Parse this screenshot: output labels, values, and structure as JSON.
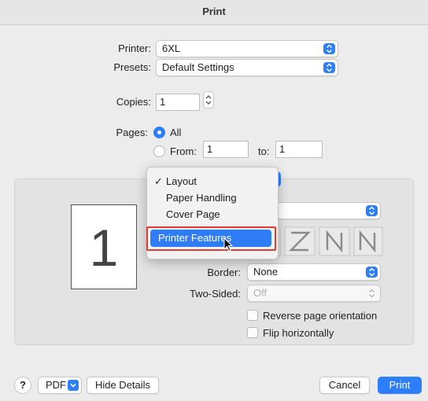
{
  "window": {
    "title": "Print"
  },
  "form": {
    "printer_label": "Printer:",
    "printer_value": "6XL",
    "presets_label": "Presets:",
    "presets_value": "Default Settings",
    "copies_label": "Copies:",
    "copies_value": "1",
    "pages_label": "Pages:",
    "pages_all": "All",
    "pages_from": "From:",
    "pages_from_value": "1",
    "pages_to": "to:",
    "pages_to_value": "1"
  },
  "menu": {
    "items": [
      {
        "label": "Layout",
        "checked": true
      },
      {
        "label": "Paper Handling",
        "checked": false
      },
      {
        "label": "Cover Page",
        "checked": false
      }
    ],
    "highlighted": "Printer Features",
    "checkmark": "✓"
  },
  "preview": {
    "page_number": "1"
  },
  "layout": {
    "border_label": "Border:",
    "border_value": "None",
    "two_sided_label": "Two-Sided:",
    "two_sided_value": "Off",
    "reverse_label": "Reverse page orientation",
    "flip_label": "Flip horizontally"
  },
  "footer": {
    "help": "?",
    "pdf": "PDF",
    "hide_details": "Hide Details",
    "cancel": "Cancel",
    "print": "Print"
  },
  "colors": {
    "accent": "#2d7ff9",
    "highlight_box": "#e03a32"
  }
}
